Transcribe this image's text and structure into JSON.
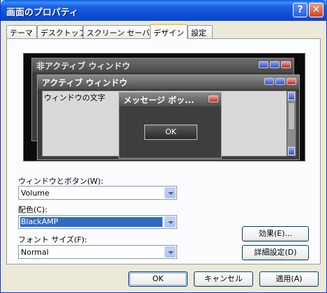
{
  "window": {
    "title": "画面のプロパティ",
    "help_glyph": "?",
    "close_glyph": "✕"
  },
  "tabs": [
    "テーマ",
    "デスクトップ",
    "スクリーン セーバー",
    "デザイン",
    "設定"
  ],
  "active_tab": "デザイン",
  "preview": {
    "inactive_title": "非アクティブ ウィンドウ",
    "active_title": "アクティブ ウィンドウ",
    "window_text": "ウィンドウの文字",
    "msgbox_title": "メッセージ ボッ...",
    "msgbox_ok": "OK"
  },
  "fields": {
    "window_buttons_label": "ウィンドウとボタン(W):",
    "window_buttons_value": "Volume",
    "color_scheme_label": "配色(C):",
    "color_scheme_value": "BlackAMP",
    "font_size_label": "フォント サイズ(F):",
    "font_size_value": "Normal"
  },
  "buttons": {
    "effects": "効果(E)...",
    "advanced": "詳細設定(D)",
    "ok": "OK",
    "cancel": "キャンセル",
    "apply": "適用(A)"
  },
  "colors": {
    "titlebar": "#0b4ed6",
    "selection": "#316ac5",
    "preview_bg": "#0b0b0b"
  }
}
